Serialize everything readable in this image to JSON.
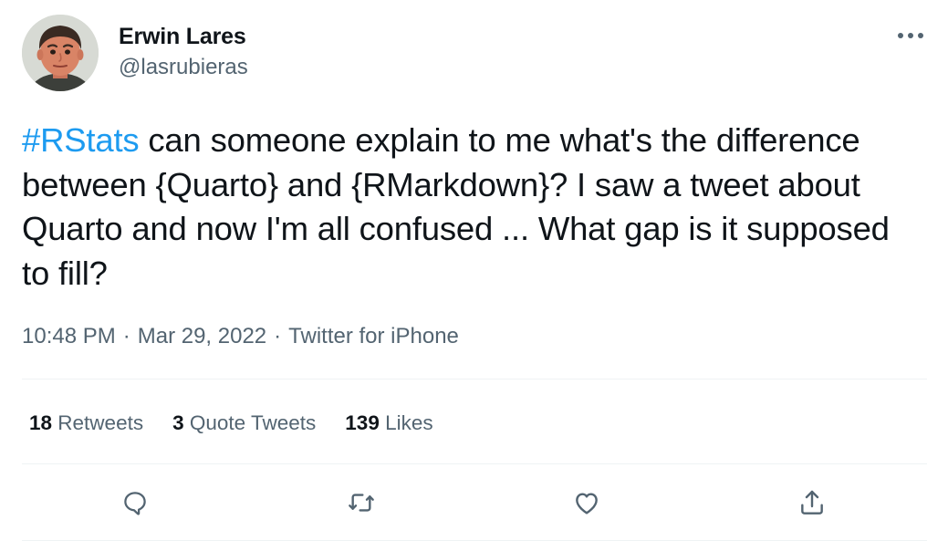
{
  "author": {
    "display_name": "Erwin Lares",
    "handle": "@lasrubieras"
  },
  "tweet": {
    "hashtag": "#RStats",
    "text": " can someone explain to me what's the difference between {Quarto} and {RMarkdown}? I saw a tweet about Quarto and now I'm all confused ... What gap is it supposed to fill?",
    "time": "10:48 PM",
    "separator": "·",
    "date": "Mar 29, 2022",
    "source": "Twitter for iPhone"
  },
  "stats": {
    "retweets_count": "18",
    "retweets_label": "Retweets",
    "quotes_count": "3",
    "quotes_label": "Quote Tweets",
    "likes_count": "139",
    "likes_label": "Likes"
  },
  "actions": {
    "reply": "reply-icon",
    "retweet": "retweet-icon",
    "like": "heart-icon",
    "share": "share-icon"
  },
  "colors": {
    "accent": "#1d9bf0",
    "text": "#0f1419",
    "secondary": "#536471",
    "divider": "#eff3f4"
  }
}
